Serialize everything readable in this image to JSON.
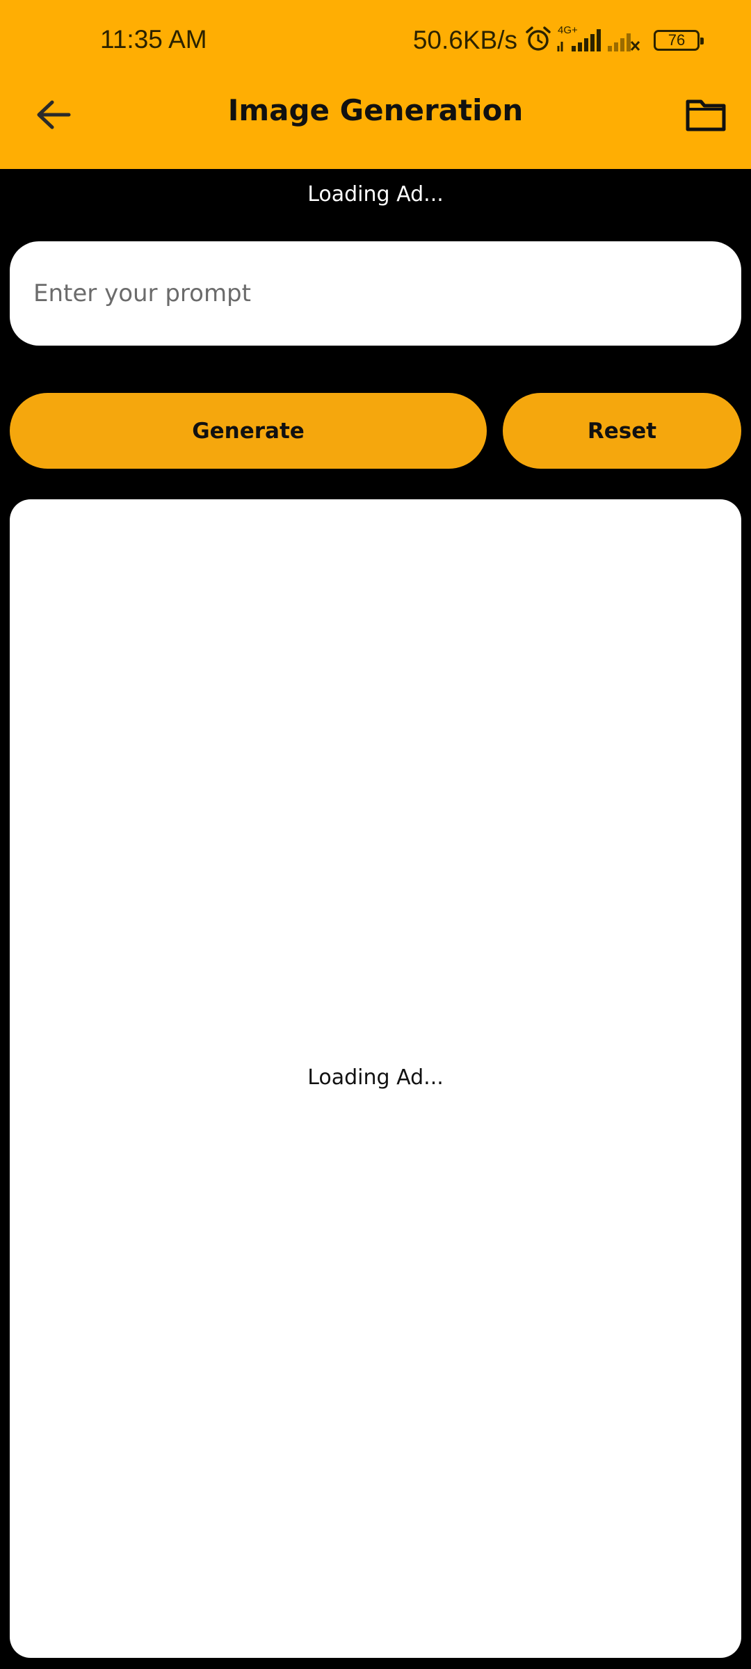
{
  "status_bar": {
    "time": "11:35 AM",
    "net_speed": "50.6KB/s",
    "network_type": "4G+",
    "battery_level": "76",
    "icons": [
      "alarm-icon",
      "signal-icon",
      "signal-no-service-icon",
      "battery-icon"
    ]
  },
  "header": {
    "title": "Image Generation",
    "back_icon": "arrow-left-icon",
    "folder_icon": "folder-icon"
  },
  "ads": {
    "top_text": "Loading Ad...",
    "center_text": "Loading Ad..."
  },
  "prompt": {
    "placeholder": "Enter your prompt",
    "value": ""
  },
  "buttons": {
    "generate_label": "Generate",
    "reset_label": "Reset"
  },
  "colors": {
    "appbar": "#FFAE03",
    "button": "#F5A70D",
    "background": "#000000",
    "card": "#FFFFFF"
  }
}
